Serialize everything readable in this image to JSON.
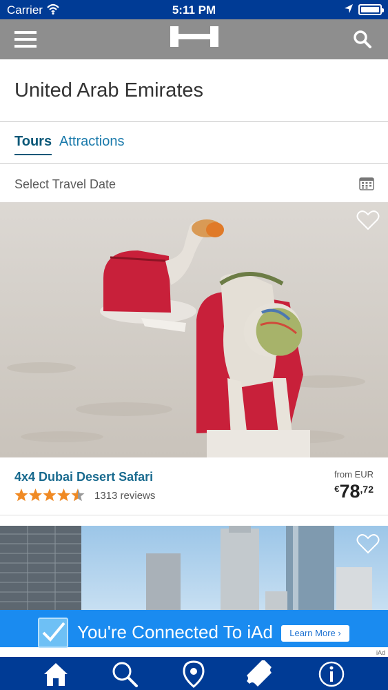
{
  "status_bar": {
    "carrier": "Carrier",
    "time": "5:11 PM",
    "icons": [
      "wifi-icon",
      "location-arrow-icon",
      "battery-icon"
    ]
  },
  "navbar": {
    "menu_icon": "hamburger-menu-icon",
    "logo": "hostelworld-h-logo",
    "search_icon": "search-icon",
    "background": "#8e8e8e"
  },
  "page": {
    "title": "United Arab Emirates"
  },
  "tabs": [
    {
      "label": "Tours",
      "active": true
    },
    {
      "label": "Attractions",
      "active": false
    }
  ],
  "date_picker": {
    "label": "Select Travel Date",
    "icon": "calendar-icon"
  },
  "cards": [
    {
      "title": "4x4 Dubai Desert Safari",
      "rating": 4.5,
      "reviews": "1313 reviews",
      "price_prefix": "from EUR",
      "currency_symbol": "€",
      "price_integer": "78",
      "price_decimal": ",72",
      "favorite_icon": "heart-outline-icon",
      "image": "camels-in-desert-photo"
    },
    {
      "favorite_icon": "heart-outline-icon",
      "image": "dubai-skyscrapers-photo"
    }
  ],
  "ad": {
    "text": "You're Connected To iAd",
    "button": "Learn More",
    "tag": "iAd",
    "background": "#1a8bf0"
  },
  "tab_bar": {
    "items": [
      "home-icon",
      "search-icon",
      "location-pin-icon",
      "ticket-icon",
      "info-icon"
    ],
    "background": "#003b95"
  },
  "colors": {
    "accent": "#1a7aab",
    "star": "#f08a24",
    "status_bar": "#003b95"
  }
}
